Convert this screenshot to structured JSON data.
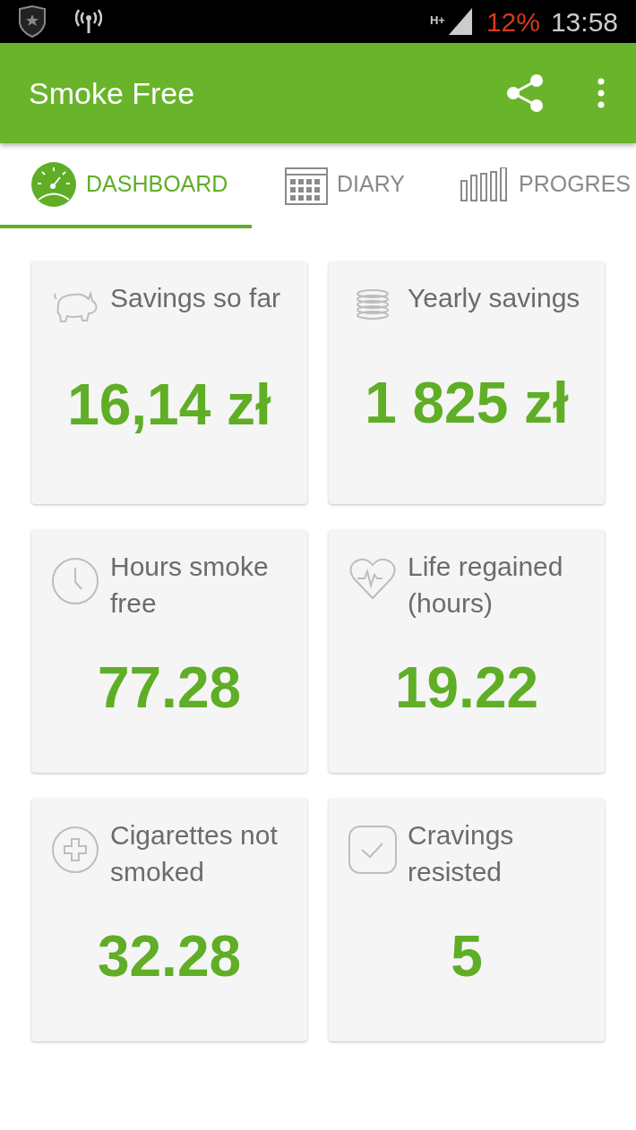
{
  "status_bar": {
    "network": "H+",
    "battery": "12%",
    "battery_low": true,
    "time": "13:58"
  },
  "app_bar": {
    "title": "Smoke Free"
  },
  "tabs": [
    {
      "label": "DASHBOARD",
      "kind": "gauge",
      "selected": true
    },
    {
      "label": "DIARY",
      "kind": "calendar",
      "selected": false
    },
    {
      "label": "PROGRES",
      "kind": "bars",
      "selected": false
    }
  ],
  "cards": [
    {
      "label": "Savings so far",
      "value": "16,14 zł",
      "kind": "piggy"
    },
    {
      "label": "Yearly savings",
      "value": "1 825 zł",
      "kind": "coins"
    },
    {
      "label": "Hours smoke free",
      "value": "77.28",
      "kind": "clock"
    },
    {
      "label": "Life regained (hours)",
      "value": "19.22",
      "kind": "heart"
    },
    {
      "label": "Cigarettes not smoked",
      "value": "32.28",
      "kind": "plus"
    },
    {
      "label": "Cravings resisted",
      "value": "5",
      "kind": "check"
    }
  ]
}
